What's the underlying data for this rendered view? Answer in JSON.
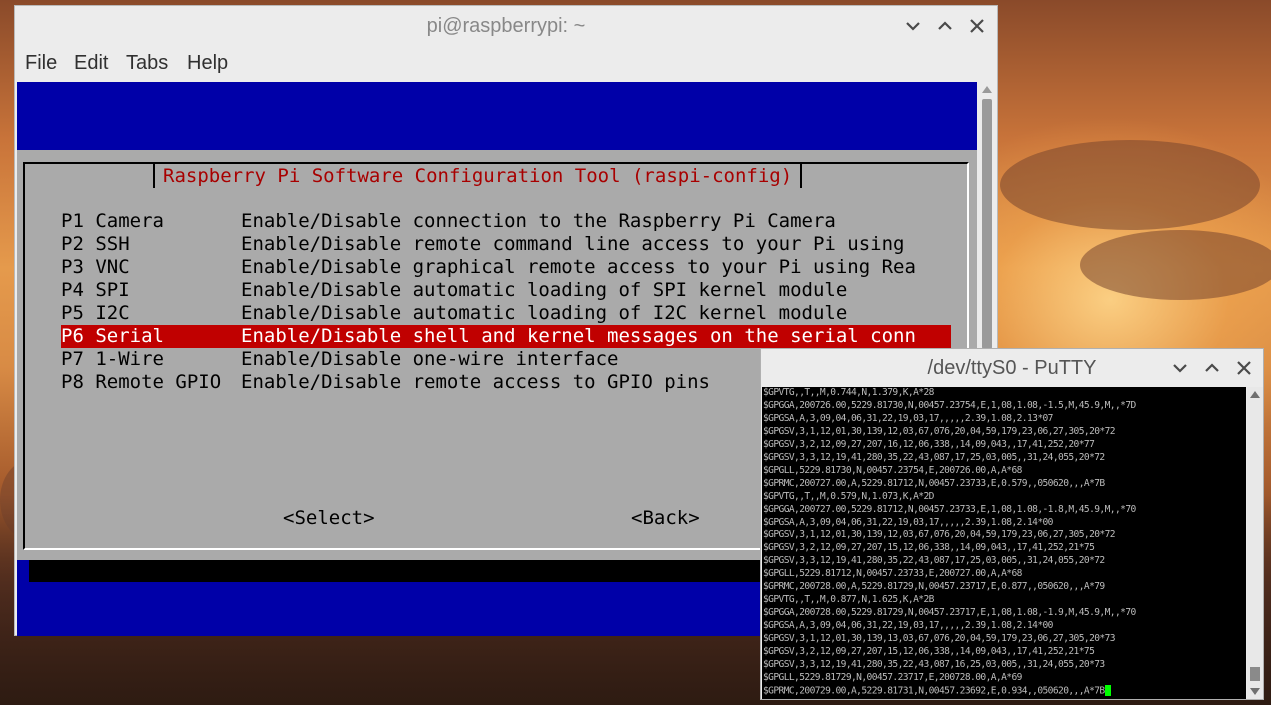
{
  "terminal": {
    "title": "pi@raspberrypi: ~",
    "menu": [
      "File",
      "Edit",
      "Tabs",
      "Help"
    ],
    "controls": {
      "minimize": "⌄",
      "maximize": "⌃",
      "close": "✕"
    }
  },
  "raspi_config": {
    "title": "Raspberry Pi Software Configuration Tool (raspi-config)",
    "items": [
      {
        "key": "P1 Camera",
        "desc": "Enable/Disable connection to the Raspberry Pi Camera"
      },
      {
        "key": "P2 SSH",
        "desc": "Enable/Disable remote command line access to your Pi using"
      },
      {
        "key": "P3 VNC",
        "desc": "Enable/Disable graphical remote access to your Pi using Rea"
      },
      {
        "key": "P4 SPI",
        "desc": "Enable/Disable automatic loading of SPI kernel module"
      },
      {
        "key": "P5 I2C",
        "desc": "Enable/Disable automatic loading of I2C kernel module"
      },
      {
        "key": "P6 Serial",
        "desc": "Enable/Disable shell and kernel messages on the serial conn"
      },
      {
        "key": "P7 1-Wire",
        "desc": "Enable/Disable one-wire interface"
      },
      {
        "key": "P8 Remote GPIO",
        "desc": "Enable/Disable remote access to GPIO pins"
      }
    ],
    "selected_index": 5,
    "buttons": {
      "select": "<Select>",
      "back": "<Back>"
    }
  },
  "putty": {
    "title": "/dev/ttyS0 - PuTTY",
    "lines": [
      "$GPVTG,,T,,M,0.744,N,1.379,K,A*28",
      "$GPGGA,200726.00,5229.81730,N,00457.23754,E,1,08,1.08,-1.5,M,45.9,M,,*7D",
      "$GPGSA,A,3,09,04,06,31,22,19,03,17,,,,,2.39,1.08,2.13*07",
      "$GPGSV,3,1,12,01,30,139,12,03,67,076,20,04,59,179,23,06,27,305,20*72",
      "$GPGSV,3,2,12,09,27,207,16,12,06,338,,14,09,043,,17,41,252,20*77",
      "$GPGSV,3,3,12,19,41,280,35,22,43,087,17,25,03,005,,31,24,055,20*72",
      "$GPGLL,5229.81730,N,00457.23754,E,200726.00,A,A*68",
      "$GPRMC,200727.00,A,5229.81712,N,00457.23733,E,0.579,,050620,,,A*7B",
      "$GPVTG,,T,,M,0.579,N,1.073,K,A*2D",
      "$GPGGA,200727.00,5229.81712,N,00457.23733,E,1,08,1.08,-1.8,M,45.9,M,,*70",
      "$GPGSA,A,3,09,04,06,31,22,19,03,17,,,,,2.39,1.08,2.14*00",
      "$GPGSV,3,1,12,01,30,139,12,03,67,076,20,04,59,179,23,06,27,305,20*72",
      "$GPGSV,3,2,12,09,27,207,15,12,06,338,,14,09,043,,17,41,252,21*75",
      "$GPGSV,3,3,12,19,41,280,35,22,43,087,17,25,03,005,,31,24,055,20*72",
      "$GPGLL,5229.81712,N,00457.23733,E,200727.00,A,A*68",
      "$GPRMC,200728.00,A,5229.81729,N,00457.23717,E,0.877,,050620,,,A*79",
      "$GPVTG,,T,,M,0.877,N,1.625,K,A*2B",
      "$GPGGA,200728.00,5229.81729,N,00457.23717,E,1,08,1.08,-1.9,M,45.9,M,,*70",
      "$GPGSA,A,3,09,04,06,31,22,19,03,17,,,,,2.39,1.08,2.14*00",
      "$GPGSV,3,1,12,01,30,139,13,03,67,076,20,04,59,179,23,06,27,305,20*73",
      "$GPGSV,3,2,12,09,27,207,15,12,06,338,,14,09,043,,17,41,252,21*75",
      "$GPGSV,3,3,12,19,41,280,35,22,43,087,16,25,03,005,,31,24,055,20*73",
      "$GPGLL,5229.81729,N,00457.23717,E,200728.00,A,A*69",
      "$GPRMC,200729.00,A,5229.81731,N,00457.23692,E,0.934,,050620,,,A*7B"
    ]
  },
  "colors": {
    "term_bg": "#0000a8",
    "dialog_bg": "#aaaaaa",
    "highlight": "#c00000",
    "title_text": "#a80000",
    "cursor": "#00ff00"
  }
}
